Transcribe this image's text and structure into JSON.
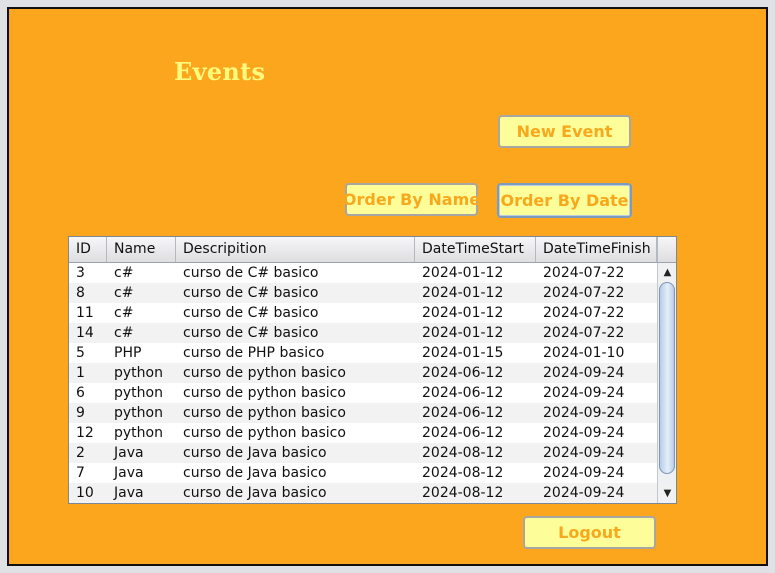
{
  "title": "Events",
  "buttons": {
    "new_event": "New Event",
    "order_by_name": "Order By Name",
    "order_by_date": "Order By Date",
    "logout": "Logout"
  },
  "table": {
    "columns": [
      "ID",
      "Name",
      "Descripition",
      "DateTimeStart",
      "DateTimeFinish"
    ],
    "rows": [
      [
        "3",
        "c#",
        "curso de C# basico",
        "2024-01-12",
        "2024-07-22"
      ],
      [
        "8",
        "c#",
        "curso de C# basico",
        "2024-01-12",
        "2024-07-22"
      ],
      [
        "11",
        "c#",
        "curso de C# basico",
        "2024-01-12",
        "2024-07-22"
      ],
      [
        "14",
        "c#",
        "curso de C# basico",
        "2024-01-12",
        "2024-07-22"
      ],
      [
        "5",
        "PHP",
        "curso de PHP basico",
        "2024-01-15",
        "2024-01-10"
      ],
      [
        "1",
        "python",
        "curso de python basico",
        "2024-06-12",
        "2024-09-24"
      ],
      [
        "6",
        "python",
        "curso de python basico",
        "2024-06-12",
        "2024-09-24"
      ],
      [
        "9",
        "python",
        "curso de python basico",
        "2024-06-12",
        "2024-09-24"
      ],
      [
        "12",
        "python",
        "curso de python basico",
        "2024-06-12",
        "2024-09-24"
      ],
      [
        "2",
        "Java",
        "curso de Java basico",
        "2024-08-12",
        "2024-09-24"
      ],
      [
        "7",
        "Java",
        "curso de Java basico",
        "2024-08-12",
        "2024-09-24"
      ],
      [
        "10",
        "Java",
        "curso de Java basico",
        "2024-08-12",
        "2024-09-24"
      ]
    ],
    "scroll_up_icon": "triangle-up-icon",
    "scroll_down_icon": "triangle-down-icon"
  },
  "colors": {
    "panel_background": "#fca61e",
    "title_text": "#fdfb7c",
    "button_background": "#fdfd9a",
    "button_text": "#f7a81c"
  }
}
